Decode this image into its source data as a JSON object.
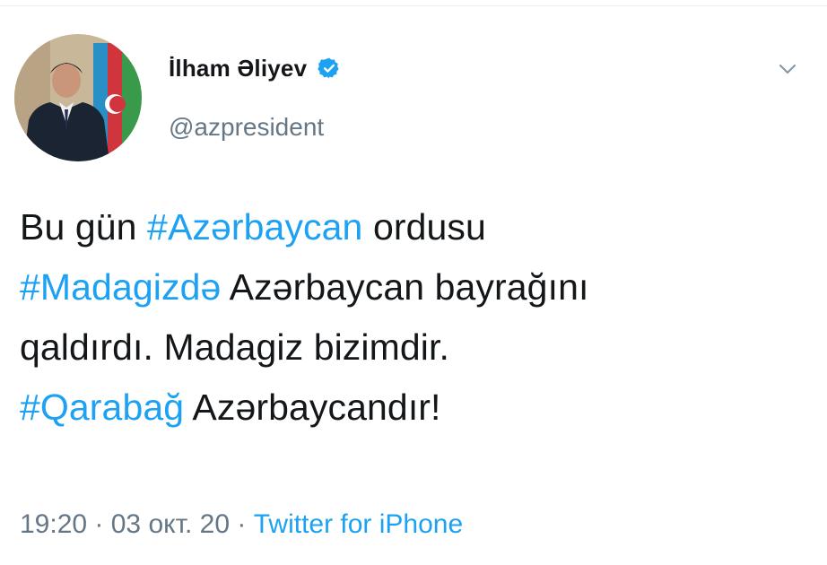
{
  "tweet": {
    "author": {
      "display_name": "İlham Əliyev",
      "handle": "@azpresident",
      "verified": true,
      "verified_icon": "verified-badge-icon",
      "avatar": "profile-photo"
    },
    "menu_icon": "chevron-down-icon",
    "text": {
      "line1": {
        "t1": "Bu gün ",
        "tag1": "#Azərbaycan",
        "t2": " ordusu"
      },
      "line2": {
        "tag1": "#Madagizdə",
        "t2": " Azərbaycan bayrağını"
      },
      "line3": {
        "t1": "qaldırdı. Madagiz bizimdir."
      },
      "line4": {
        "tag1": "#Qarabağ",
        "t2": " Azərbaycandır!"
      }
    },
    "meta": {
      "time": "19:20",
      "sep1": " · ",
      "date": "03 окт. 20",
      "sep2": " · ",
      "source": "Twitter for iPhone"
    }
  },
  "colors": {
    "accent": "#1da1f2",
    "text": "#14171a",
    "muted": "#657786"
  }
}
